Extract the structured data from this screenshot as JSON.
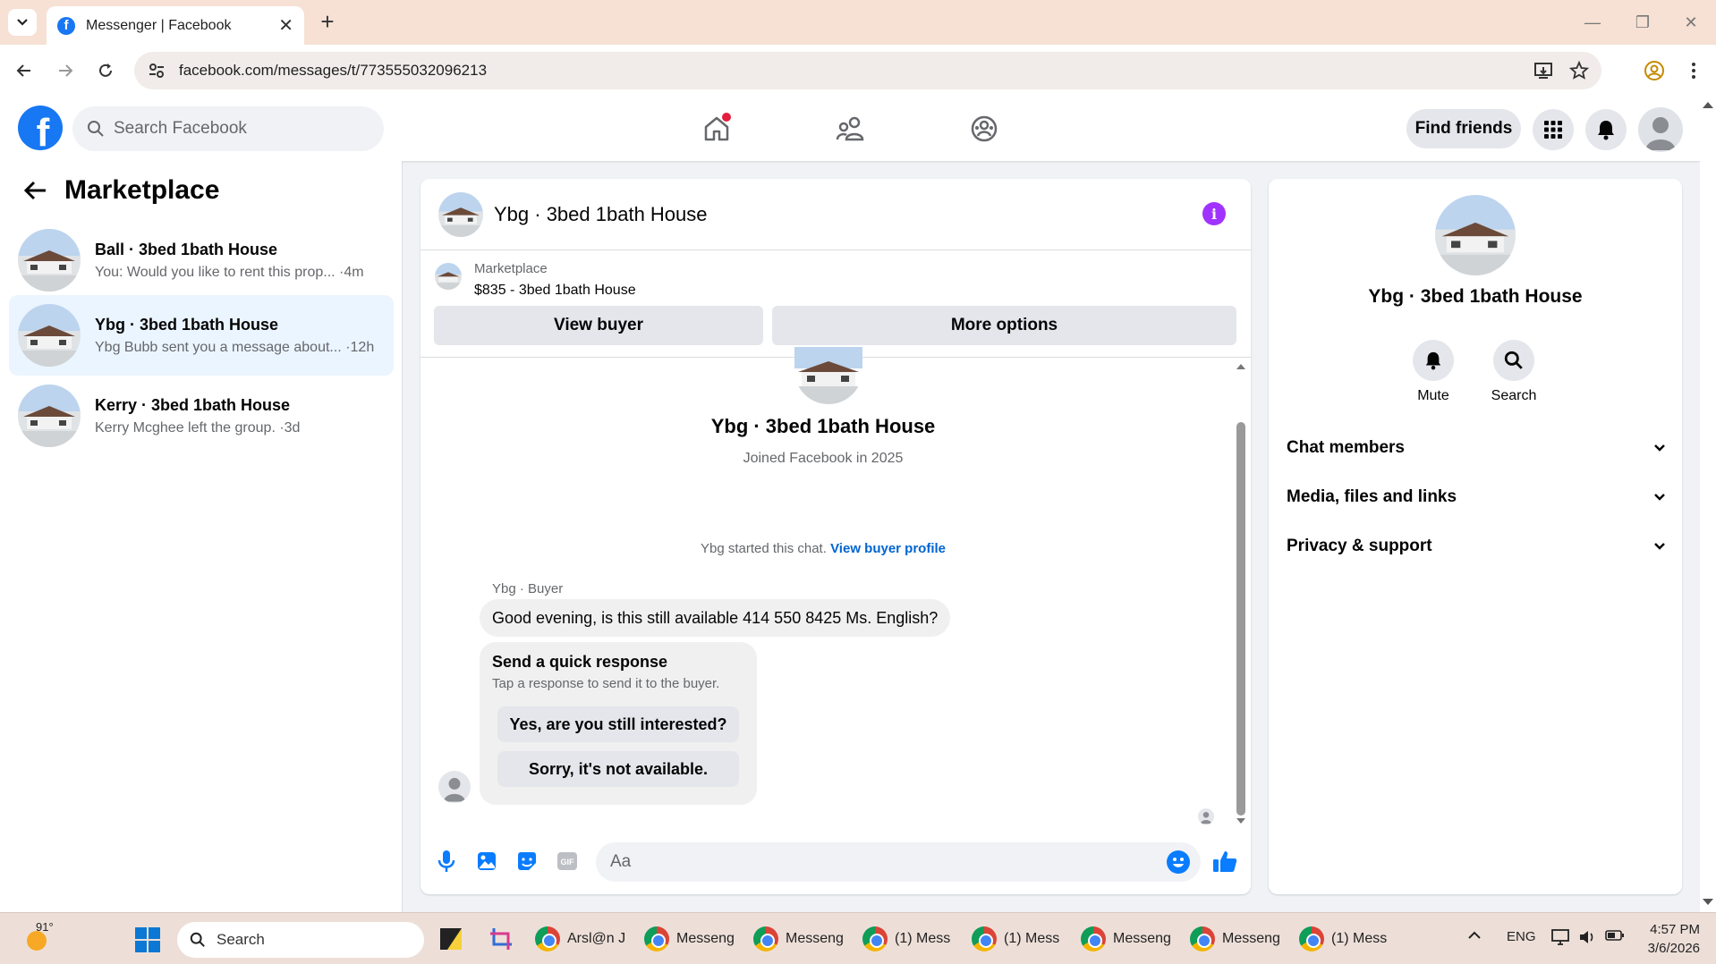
{
  "browser": {
    "tab_title": "Messenger | Facebook",
    "url": "facebook.com/messages/t/773555032096213"
  },
  "fb": {
    "search_placeholder": "Search Facebook",
    "find_friends": "Find friends",
    "home_notification": true
  },
  "sidebar": {
    "title": "Marketplace",
    "conversations": [
      {
        "name": "Ball · 3bed 1bath House",
        "preview": "You: Would you like to rent this prop... ·4m",
        "active": false
      },
      {
        "name": "Ybg · 3bed 1bath House",
        "preview": "Ybg Bubb sent you a message about... ·12h",
        "active": true
      },
      {
        "name": "Kerry · 3bed 1bath House",
        "preview": "Kerry Mcghee left the group. ·3d",
        "active": false
      }
    ]
  },
  "chat": {
    "title": "Ybg · 3bed 1bath House",
    "listing_source": "Marketplace",
    "listing_price": "$835 - 3bed 1bath House",
    "view_buyer": "View buyer",
    "more_options": "More options",
    "profile_name": "Ybg · 3bed 1bath House",
    "joined": "Joined Facebook in 2025",
    "started_text": "Ybg started this chat.",
    "view_buyer_profile": "View buyer profile",
    "sender_label": "Ybg · Buyer",
    "message": "Good evening, is this still available 414 550 8425 Ms. English?",
    "quick_title": "Send a quick response",
    "quick_sub": "Tap a response to send it to the buyer.",
    "quick_1": "Yes, are you still interested?",
    "quick_2": "Sorry, it's not available.",
    "composer_placeholder": "Aa"
  },
  "details": {
    "name": "Ybg · 3bed 1bath House",
    "mute": "Mute",
    "search": "Search",
    "sections": [
      "Chat members",
      "Media, files and links",
      "Privacy & support"
    ]
  },
  "taskbar": {
    "temperature": "91°",
    "search_placeholder": "Search",
    "apps": [
      "Arsl@n J",
      "Messeng",
      "Messeng",
      "(1) Mess",
      "(1) Mess",
      "Messeng",
      "Messeng",
      "(1) Mess"
    ],
    "language": "ENG",
    "time": "4:57 PM",
    "date": "3/6/2026"
  },
  "colors": {
    "fb_blue": "#1877f2",
    "link_blue": "#0064d1",
    "active_row": "#ebf5ff",
    "info_purple": "#a033ff"
  }
}
